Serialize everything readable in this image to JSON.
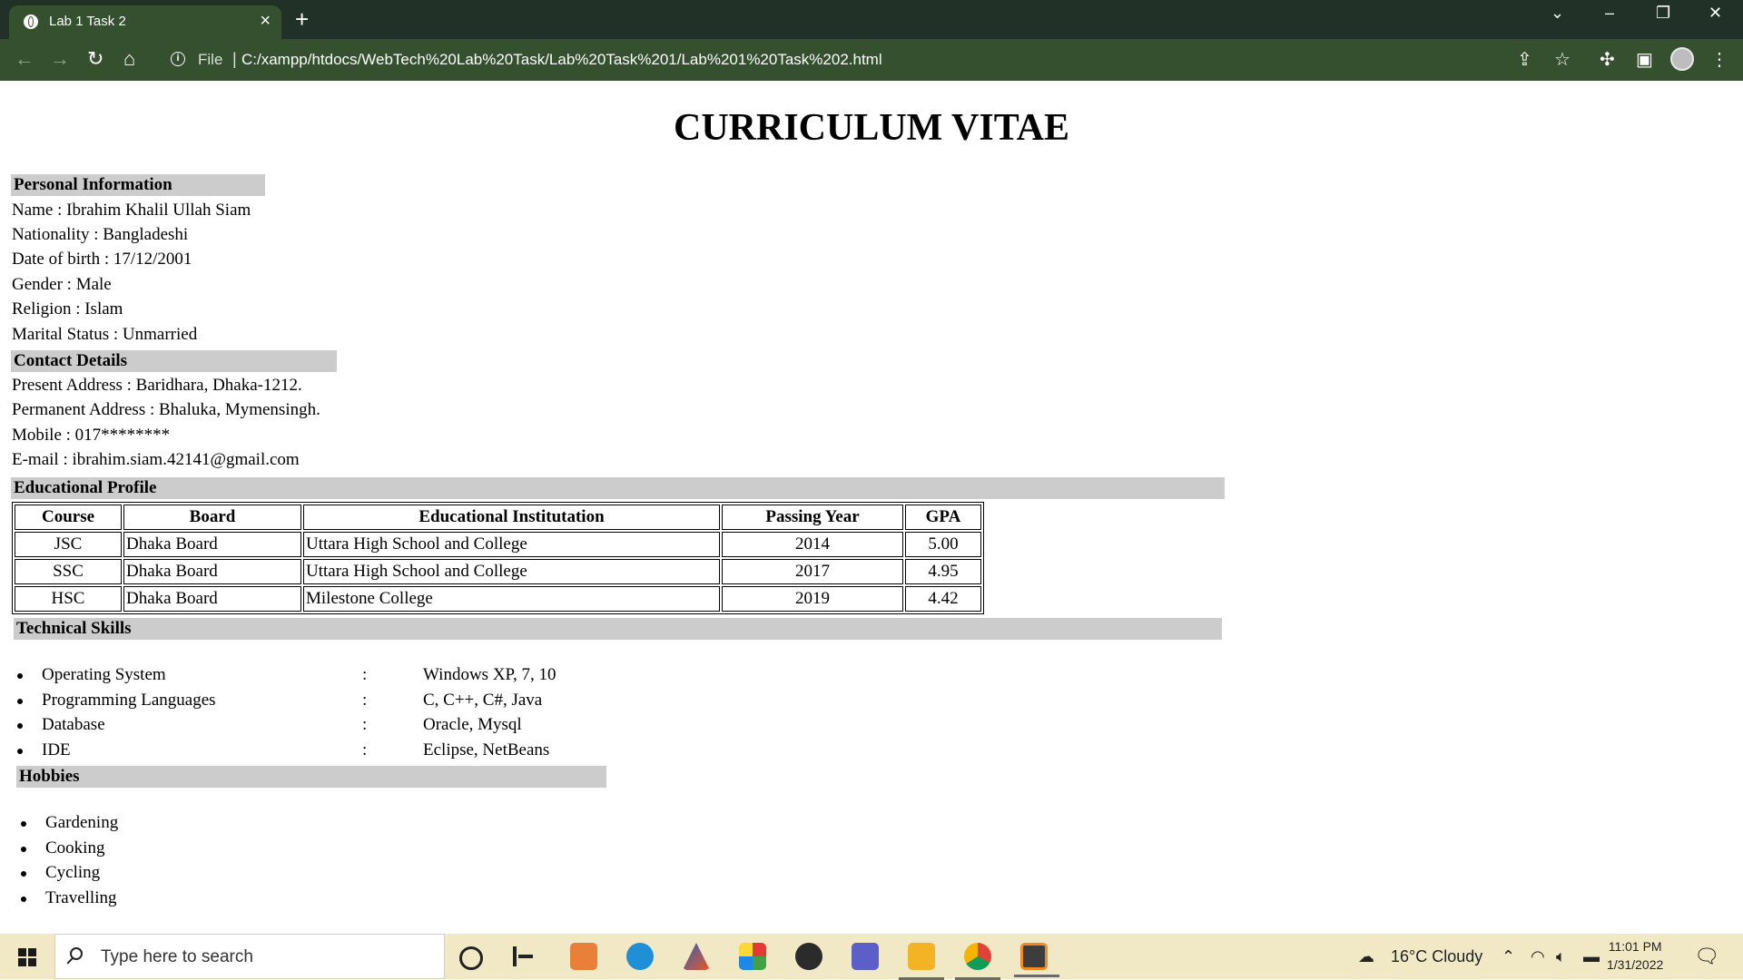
{
  "browser": {
    "tab_title": "Lab 1 Task 2",
    "url_scheme_label": "File",
    "url": "C:/xampp/htdocs/WebTech%20Lab%20Task/Lab%20Task%201/Lab%201%20Task%202.html"
  },
  "page": {
    "heading": "CURRICULUM VITAE",
    "personal": {
      "title": "Personal Information",
      "lines": [
        "Name : Ibrahim Khalil Ullah Siam",
        "Nationality : Bangladeshi",
        "Date of birth : 17/12/2001",
        "Gender : Male",
        "Religion : Islam",
        "Marital Status : Unmarried"
      ]
    },
    "contact": {
      "title": "Contact Details",
      "lines": [
        "Present Address : Baridhara, Dhaka-1212.",
        "Permanent Address : Bhaluka, Mymensingh.",
        "Mobile : 017********",
        "E-mail : ibrahim.siam.42141@gmail.com"
      ]
    },
    "education": {
      "title": "Educational Profile",
      "headers": [
        "Course",
        "Board",
        "Educational Institutation",
        "Passing Year",
        "GPA"
      ],
      "rows": [
        [
          "JSC",
          "Dhaka Board",
          "Uttara High School and College",
          "2014",
          "5.00"
        ],
        [
          "SSC",
          "Dhaka Board",
          "Uttara High School and College",
          "2017",
          "4.95"
        ],
        [
          "HSC",
          "Dhaka Board",
          "Milestone College",
          "2019",
          "4.42"
        ]
      ]
    },
    "skills": {
      "title": "Technical Skills",
      "separator": ":",
      "items": [
        {
          "name": "Operating System",
          "value": "Windows XP, 7, 10"
        },
        {
          "name": "Programming Languages",
          "value": "C, C++, C#, Java"
        },
        {
          "name": "Database",
          "value": "Oracle, Mysql"
        },
        {
          "name": "IDE",
          "value": "Eclipse, NetBeans"
        }
      ]
    },
    "hobbies": {
      "title": "Hobbies",
      "items": [
        "Gardening",
        "Cooking",
        "Cycling",
        "Travelling"
      ]
    }
  },
  "taskbar": {
    "search_placeholder": "Type here to search",
    "weather": "16°C  Cloudy",
    "time": "11:01 PM",
    "date": "1/31/2022"
  }
}
